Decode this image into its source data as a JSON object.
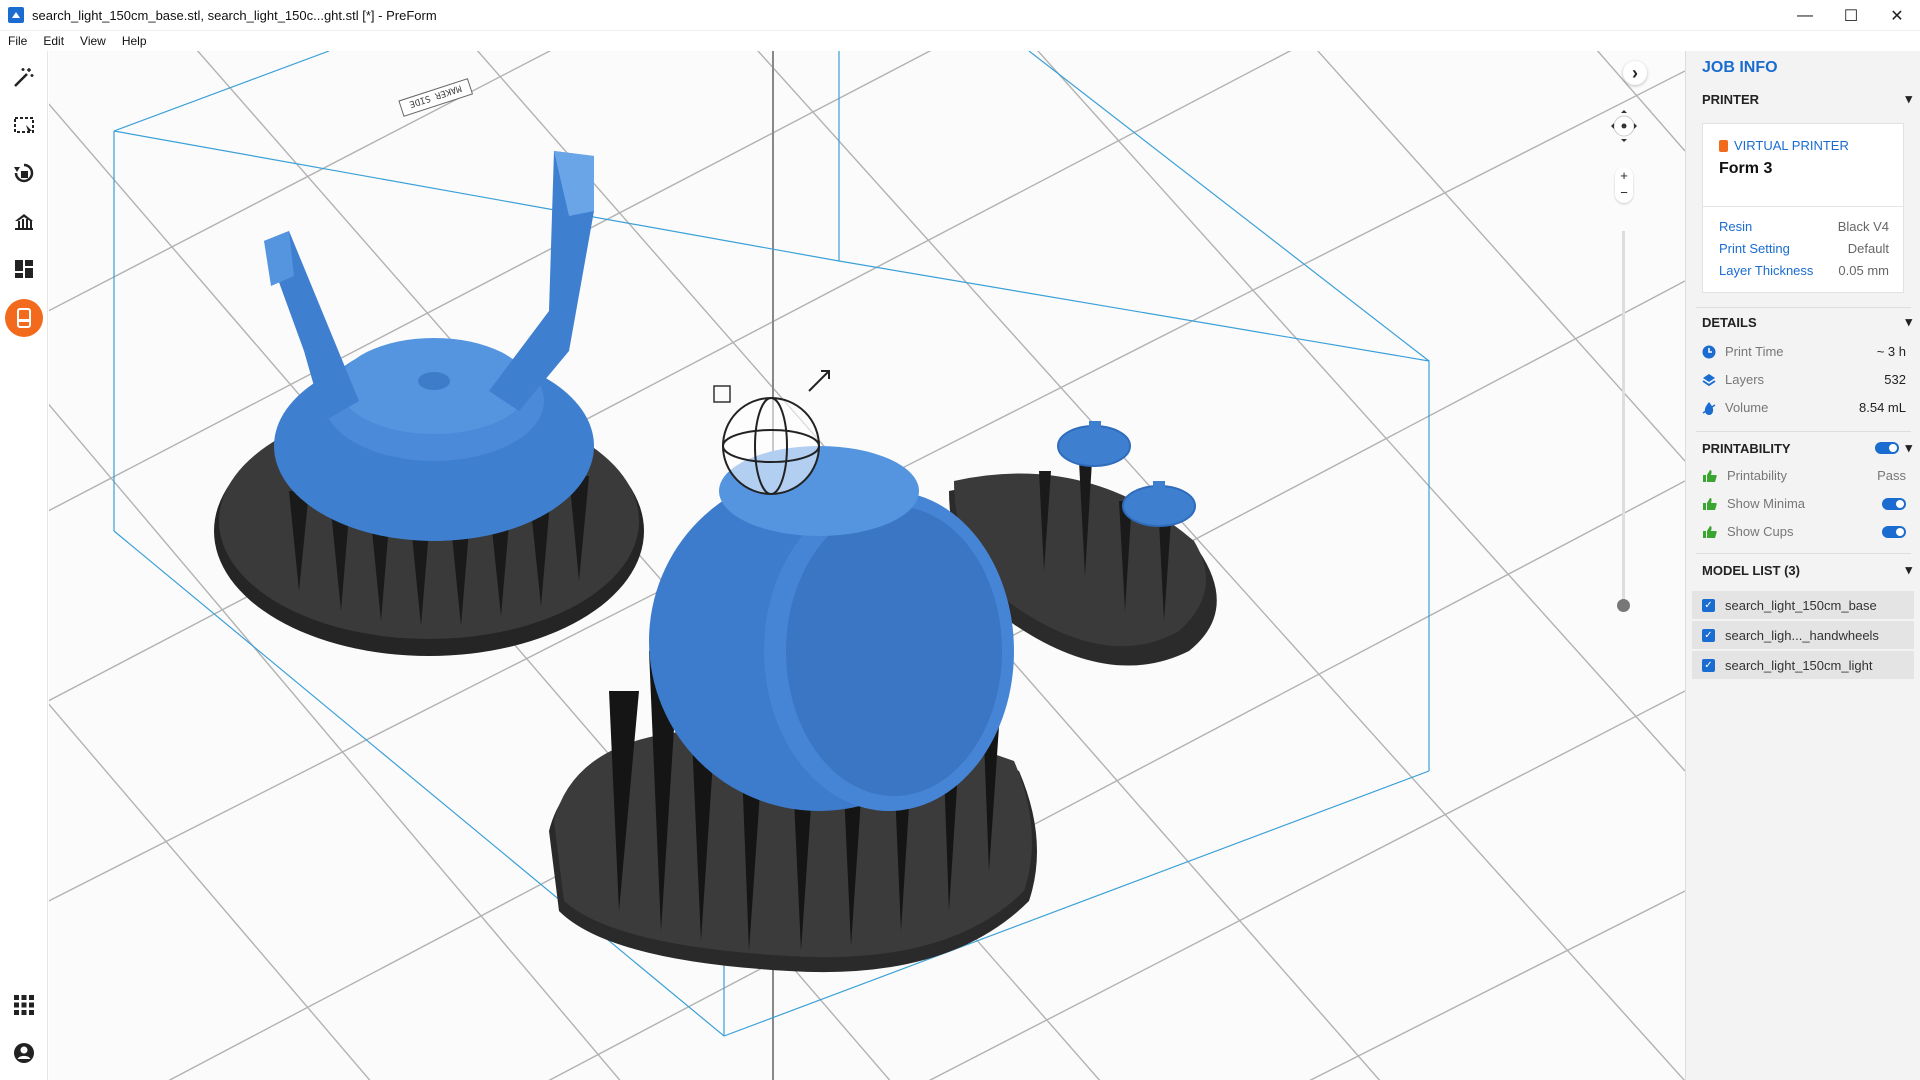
{
  "window": {
    "title": "search_light_150cm_base.stl, search_light_150c...ght.stl [*] - PreForm",
    "minimize": "—",
    "maximize": "☐",
    "close": "✕"
  },
  "menu": [
    "File",
    "Edit",
    "View",
    "Help"
  ],
  "toolbar": {
    "tools": [
      "magic-wand-icon",
      "box-select-icon",
      "orientation-icon",
      "supports-icon",
      "layout-icon",
      "printer-icon"
    ],
    "bottom": [
      "apps-grid-icon",
      "account-icon"
    ],
    "accent": "#f26b1d"
  },
  "viewport": {
    "platform_label": "MAKER SIDE",
    "expand_arrow": "›"
  },
  "panel": {
    "title": "JOB INFO",
    "printer": {
      "heading": "PRINTER",
      "type": "VIRTUAL PRINTER",
      "model": "Form 3",
      "props": [
        {
          "k": "Resin",
          "v": "Black V4"
        },
        {
          "k": "Print Setting",
          "v": "Default"
        },
        {
          "k": "Layer Thickness",
          "v": "0.05 mm"
        }
      ]
    },
    "details": {
      "heading": "DETAILS",
      "rows": [
        {
          "icon": "clock-icon",
          "label": "Print Time",
          "value": "~ 3 h"
        },
        {
          "icon": "layers-icon",
          "label": "Layers",
          "value": "532"
        },
        {
          "icon": "resin-drop-icon",
          "label": "Volume",
          "value": "8.54 mL"
        }
      ]
    },
    "printability": {
      "heading": "PRINTABILITY",
      "rows": [
        {
          "label": "Printability",
          "value": "Pass"
        },
        {
          "label": "Show Minima",
          "value": ""
        },
        {
          "label": "Show Cups",
          "value": ""
        }
      ]
    },
    "model_list": {
      "heading": "MODEL LIST (3)",
      "items": [
        "search_light_150cm_base",
        "search_ligh..._handwheels",
        "search_light_150cm_light"
      ]
    }
  },
  "colors": {
    "accent_blue": "#1a6cd0",
    "model_blue": "#4a86d4",
    "support_black": "#2a2a2a",
    "thumbs_green": "#3aa531"
  }
}
